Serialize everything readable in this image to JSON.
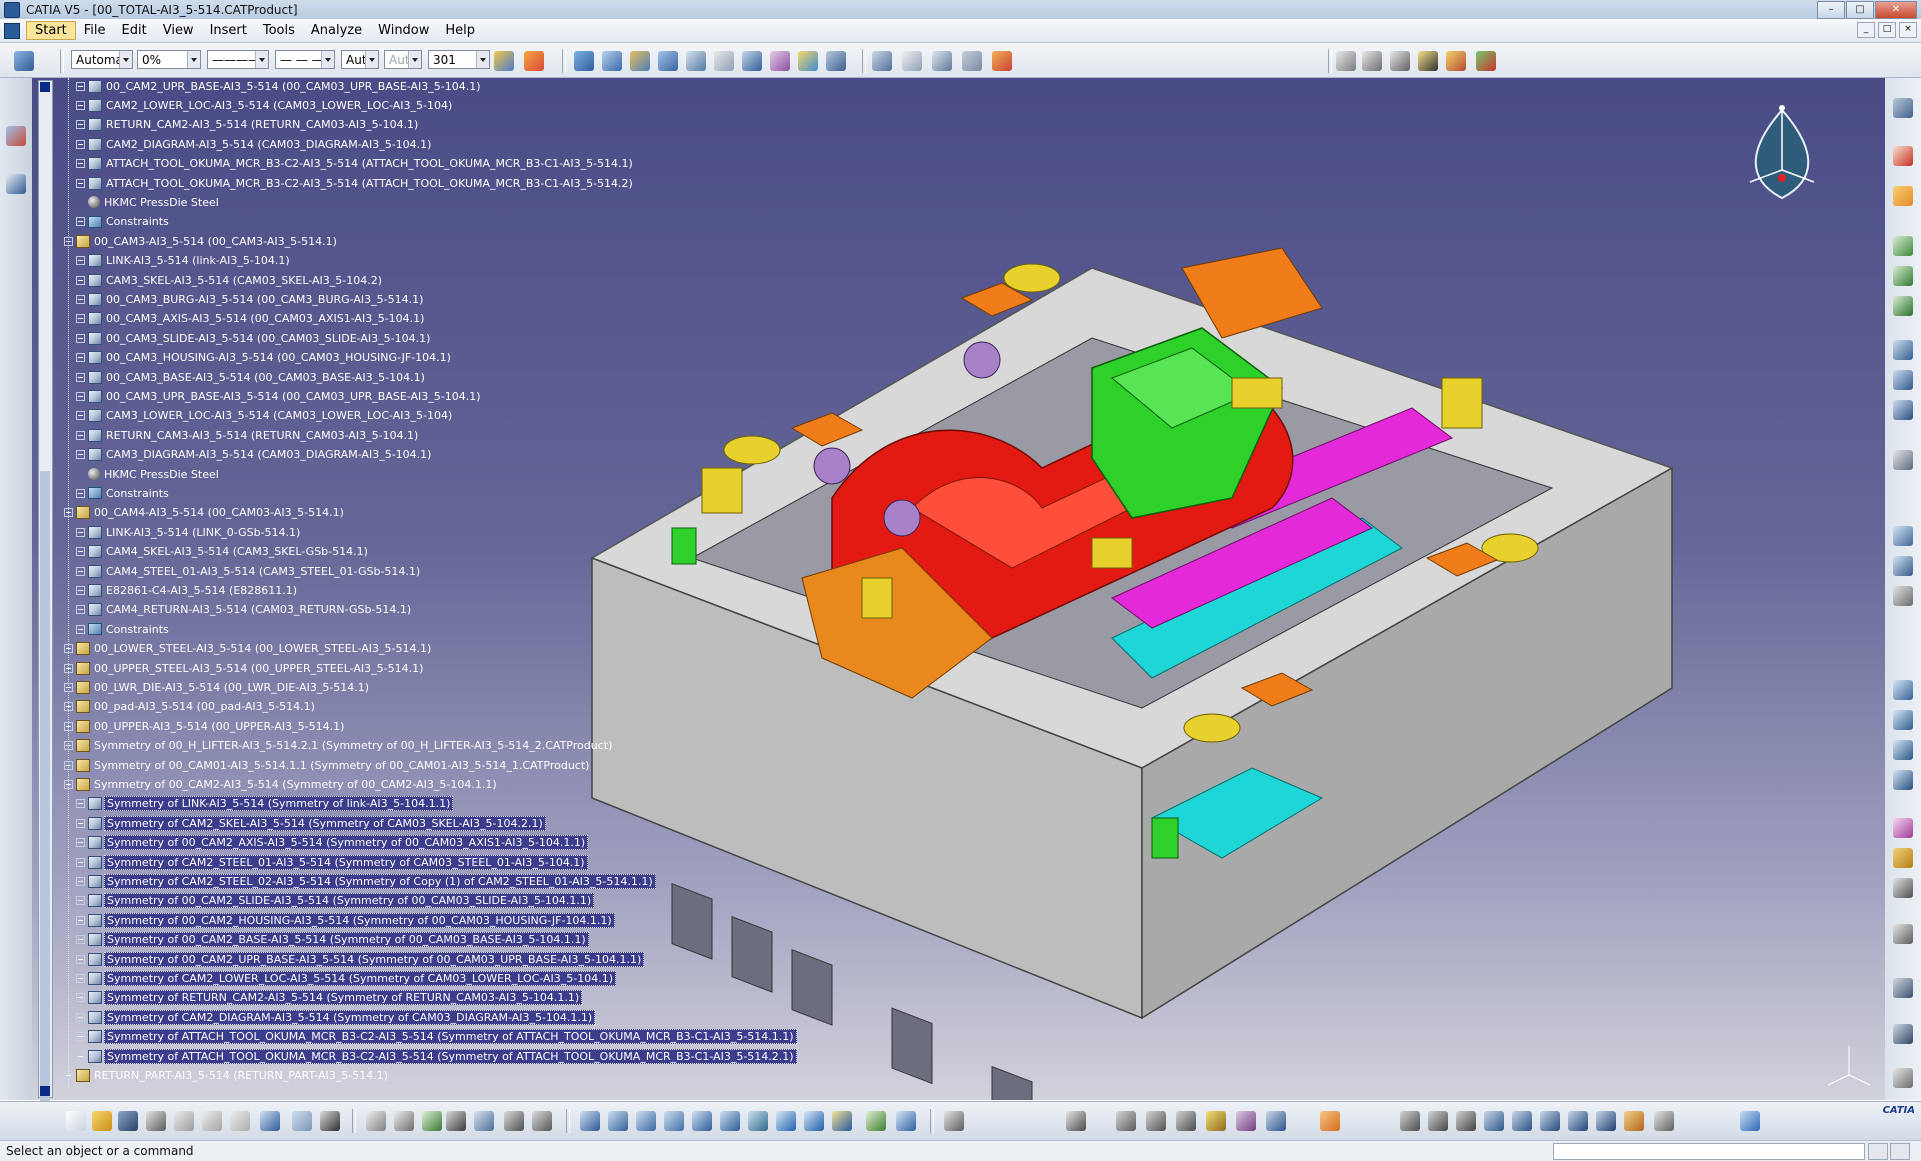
{
  "window": {
    "title": "CATIA V5 - [00_TOTAL-AI3_5-514.CATProduct]",
    "controls": [
      "–",
      "□",
      "✕"
    ]
  },
  "menu": {
    "items": [
      "Start",
      "File",
      "Edit",
      "View",
      "Insert",
      "Tools",
      "Analyze",
      "Window",
      "Help"
    ],
    "mdi_controls": [
      "_",
      "□",
      "×"
    ]
  },
  "properties_toolbar": {
    "color_value": "Automa",
    "transparency_value": "0%",
    "linetype_value": "————",
    "linestyle_value": "— — —",
    "thickness_value": "Aut",
    "point_value": "Aut",
    "layer_value": "301"
  },
  "tree": {
    "nodes": [
      {
        "label": "00_CAM2_UPR_BASE-AI3_5-514 (00_CAM03_UPR_BASE-AI3_5-104.1)",
        "level": 2,
        "icon": "part-icon",
        "expander": "plus",
        "selected": false
      },
      {
        "label": "CAM2_LOWER_LOC-AI3_5-514 (CAM03_LOWER_LOC-AI3_5-104)",
        "level": 2,
        "icon": "part-icon",
        "expander": "plus",
        "selected": false
      },
      {
        "label": "RETURN_CAM2-AI3_5-514 (RETURN_CAM03-AI3_5-104.1)",
        "level": 2,
        "icon": "part-icon",
        "expander": "plus",
        "selected": false
      },
      {
        "label": "CAM2_DIAGRAM-AI3_5-514 (CAM03_DIAGRAM-AI3_5-104.1)",
        "level": 2,
        "icon": "part-icon",
        "expander": "plus",
        "selected": false
      },
      {
        "label": "ATTACH_TOOL_OKUMA_MCR_B3-C2-AI3_5-514 (ATTACH_TOOL_OKUMA_MCR_B3-C1-AI3_5-514.1)",
        "level": 2,
        "icon": "part-icon",
        "expander": "plus",
        "selected": false
      },
      {
        "label": "ATTACH_TOOL_OKUMA_MCR_B3-C2-AI3_5-514 (ATTACH_TOOL_OKUMA_MCR_B3-C1-AI3_5-514.2)",
        "level": 2,
        "icon": "part-icon",
        "expander": "plus",
        "selected": false
      },
      {
        "label": "HKMC PressDie Steel",
        "level": 2,
        "icon": "material-icon",
        "expander": "none",
        "selected": false
      },
      {
        "label": "Constraints",
        "level": 2,
        "icon": "constraints-icon",
        "expander": "plus",
        "selected": false
      },
      {
        "label": "00_CAM3-AI3_5-514 (00_CAM3-AI3_5-514.1)",
        "level": 1,
        "icon": "product-icon",
        "expander": "minus",
        "selected": false
      },
      {
        "label": "LINK-AI3_5-514 (link-AI3_5-104.1)",
        "level": 2,
        "icon": "part-icon",
        "expander": "plus",
        "selected": false
      },
      {
        "label": "CAM3_SKEL-AI3_5-514 (CAM03_SKEL-AI3_5-104.2)",
        "level": 2,
        "icon": "part-icon",
        "expander": "plus",
        "selected": false
      },
      {
        "label": "00_CAM3_BURG-AI3_5-514 (00_CAM3_BURG-AI3_5-514.1)",
        "level": 2,
        "icon": "part-icon",
        "expander": "plus",
        "selected": false
      },
      {
        "label": "00_CAM3_AXIS-AI3_5-514 (00_CAM03_AXIS1-AI3_5-104.1)",
        "level": 2,
        "icon": "part-icon",
        "expander": "plus",
        "selected": false
      },
      {
        "label": "00_CAM3_SLIDE-AI3_5-514 (00_CAM03_SLIDE-AI3_5-104.1)",
        "level": 2,
        "icon": "part-icon",
        "expander": "plus",
        "selected": false
      },
      {
        "label": "00_CAM3_HOUSING-AI3_5-514 (00_CAM03_HOUSING-JF-104.1)",
        "level": 2,
        "icon": "part-icon",
        "expander": "plus",
        "selected": false
      },
      {
        "label": "00_CAM3_BASE-AI3_5-514 (00_CAM03_BASE-AI3_5-104.1)",
        "level": 2,
        "icon": "part-icon",
        "expander": "plus",
        "selected": false
      },
      {
        "label": "00_CAM3_UPR_BASE-AI3_5-514 (00_CAM03_UPR_BASE-AI3_5-104.1)",
        "level": 2,
        "icon": "part-icon",
        "expander": "plus",
        "selected": false
      },
      {
        "label": "CAM3_LOWER_LOC-AI3_5-514 (CAM03_LOWER_LOC-AI3_5-104)",
        "level": 2,
        "icon": "part-icon",
        "expander": "plus",
        "selected": false
      },
      {
        "label": "RETURN_CAM3-AI3_5-514 (RETURN_CAM03-AI3_5-104.1)",
        "level": 2,
        "icon": "part-icon",
        "expander": "plus",
        "selected": false
      },
      {
        "label": "CAM3_DIAGRAM-AI3_5-514 (CAM03_DIAGRAM-AI3_5-104.1)",
        "level": 2,
        "icon": "part-icon",
        "expander": "plus",
        "selected": false
      },
      {
        "label": "HKMC PressDie Steel",
        "level": 2,
        "icon": "material-icon",
        "expander": "none",
        "selected": false
      },
      {
        "label": "Constraints",
        "level": 2,
        "icon": "constraints-icon",
        "expander": "plus",
        "selected": false
      },
      {
        "label": "00_CAM4-AI3_5-514 (00_CAM03-AI3_5-514.1)",
        "level": 1,
        "icon": "product-icon",
        "expander": "minus",
        "selected": false
      },
      {
        "label": "LINK-AI3_5-514 (LINK_0-GSb-514.1)",
        "level": 2,
        "icon": "part-icon",
        "expander": "plus",
        "selected": false
      },
      {
        "label": "CAM4_SKEL-AI3_5-514 (CAM3_SKEL-GSb-514.1)",
        "level": 2,
        "icon": "part-icon",
        "expander": "plus",
        "selected": false
      },
      {
        "label": "CAM4_STEEL_01-AI3_5-514 (CAM3_STEEL_01-GSb-514.1)",
        "level": 2,
        "icon": "part-icon",
        "expander": "plus",
        "selected": false
      },
      {
        "label": "E82861-C4-AI3_5-514 (E828611.1)",
        "level": 2,
        "icon": "part-icon",
        "expander": "plus",
        "selected": false
      },
      {
        "label": "CAM4_RETURN-AI3_5-514 (CAM03_RETURN-GSb-514.1)",
        "level": 2,
        "icon": "part-icon",
        "expander": "plus",
        "selected": false
      },
      {
        "label": "Constraints",
        "level": 2,
        "icon": "constraints-icon",
        "expander": "plus",
        "selected": false
      },
      {
        "label": "00_LOWER_STEEL-AI3_5-514 (00_LOWER_STEEL-AI3_5-514.1)",
        "level": 1,
        "icon": "product-icon",
        "expander": "plus",
        "selected": false
      },
      {
        "label": "00_UPPER_STEEL-AI3_5-514 (00_UPPER_STEEL-AI3_5-514.1)",
        "level": 1,
        "icon": "product-icon",
        "expander": "plus",
        "selected": false
      },
      {
        "label": "00_LWR_DIE-AI3_5-514 (00_LWR_DIE-AI3_5-514.1)",
        "level": 1,
        "icon": "product-icon",
        "expander": "plus",
        "selected": false
      },
      {
        "label": "00_pad-AI3_5-514 (00_pad-AI3_5-514.1)",
        "level": 1,
        "icon": "product-icon",
        "expander": "plus",
        "selected": false
      },
      {
        "label": "00_UPPER-AI3_5-514 (00_UPPER-AI3_5-514.1)",
        "level": 1,
        "icon": "product-icon",
        "expander": "plus",
        "selected": false
      },
      {
        "label": "Symmetry of 00_H_LIFTER-AI3_5-514.2.1 (Symmetry of 00_H_LIFTER-AI3_5-514_2.CATProduct)",
        "level": 1,
        "icon": "product-icon",
        "expander": "plus",
        "selected": false
      },
      {
        "label": "Symmetry of 00_CAM01-AI3_5-514.1.1 (Symmetry of 00_CAM01-AI3_5-514_1.CATProduct)",
        "level": 1,
        "icon": "product-icon",
        "expander": "plus",
        "selected": false
      },
      {
        "label": "Symmetry of 00_CAM2-AI3_5-514 (Symmetry of 00_CAM2-AI3_5-104.1.1)",
        "level": 1,
        "icon": "product-icon",
        "expander": "minus",
        "selected": false
      },
      {
        "label": "Symmetry of LINK-AI3_5-514 (Symmetry of link-AI3_5-104.1.1)",
        "level": 2,
        "icon": "part-icon",
        "expander": "plus",
        "selected": true
      },
      {
        "label": "Symmetry of CAM2_SKEL-AI3_5-514 (Symmetry of CAM03_SKEL-AI3_5-104.2.1)",
        "level": 2,
        "icon": "part-icon",
        "expander": "plus",
        "selected": true
      },
      {
        "label": "Symmetry of 00_CAM2_AXIS-AI3_5-514 (Symmetry of 00_CAM03_AXIS1-AI3_5-104.1.1)",
        "level": 2,
        "icon": "part-icon",
        "expander": "plus",
        "selected": true
      },
      {
        "label": "Symmetry of CAM2_STEEL_01-AI3_5-514 (Symmetry of CAM03_STEEL_01-AI3_5-104.1)",
        "level": 2,
        "icon": "part-icon",
        "expander": "plus",
        "selected": true
      },
      {
        "label": "Symmetry of CAM2_STEEL_02-AI3_5-514 (Symmetry of Copy (1) of CAM2_STEEL_01-AI3_5-514.1.1)",
        "level": 2,
        "icon": "part-icon",
        "expander": "plus",
        "selected": true
      },
      {
        "label": "Symmetry of 00_CAM2_SLIDE-AI3_5-514 (Symmetry of 00_CAM03_SLIDE-AI3_5-104.1.1)",
        "level": 2,
        "icon": "part-icon",
        "expander": "plus",
        "selected": true
      },
      {
        "label": "Symmetry of 00_CAM2_HOUSING-AI3_5-514 (Symmetry of 00_CAM03_HOUSING-JF-104.1.1)",
        "level": 2,
        "icon": "part-icon",
        "expander": "plus",
        "selected": true
      },
      {
        "label": "Symmetry of 00_CAM2_BASE-AI3_5-514 (Symmetry of 00_CAM03_BASE-AI3_5-104.1.1)",
        "level": 2,
        "icon": "part-icon",
        "expander": "plus",
        "selected": true
      },
      {
        "label": "Symmetry of 00_CAM2_UPR_BASE-AI3_5-514 (Symmetry of 00_CAM03_UPR_BASE-AI3_5-104.1.1)",
        "level": 2,
        "icon": "part-icon",
        "expander": "plus",
        "selected": true
      },
      {
        "label": "Symmetry of CAM2_LOWER_LOC-AI3_5-514 (Symmetry of CAM03_LOWER_LOC-AI3_5-104.1)",
        "level": 2,
        "icon": "part-icon",
        "expander": "plus",
        "selected": true
      },
      {
        "label": "Symmetry of RETURN_CAM2-AI3_5-514 (Symmetry of RETURN_CAM03-AI3_5-104.1.1)",
        "level": 2,
        "icon": "part-icon",
        "expander": "plus",
        "selected": true
      },
      {
        "label": "Symmetry of CAM2_DIAGRAM-AI3_5-514 (Symmetry of CAM03_DIAGRAM-AI3_5-104.1.1)",
        "level": 2,
        "icon": "part-icon",
        "expander": "plus",
        "selected": true
      },
      {
        "label": "Symmetry of ATTACH_TOOL_OKUMA_MCR_B3-C2-AI3_5-514 (Symmetry of ATTACH_TOOL_OKUMA_MCR_B3-C1-AI3_5-514.1.1)",
        "level": 2,
        "icon": "part-icon",
        "expander": "plus",
        "selected": true
      },
      {
        "label": "Symmetry of ATTACH_TOOL_OKUMA_MCR_B3-C2-AI3_5-514 (Symmetry of ATTACH_TOOL_OKUMA_MCR_B3-C1-AI3_5-514.2.1)",
        "level": 2,
        "icon": "part-icon",
        "expander": "plus",
        "selected": true
      },
      {
        "label": "RETURN_PART-AI3_5-514 (RETURN_PART-AI3_5-514.1)",
        "level": 1,
        "icon": "product-icon",
        "expander": "plus",
        "selected": false
      }
    ]
  },
  "status": {
    "text": "Select an object or a command"
  },
  "logo": {
    "text": "CATIA"
  },
  "colors": {
    "viewport_top": "#4a4b86",
    "viewport_bottom": "#d2d2dc",
    "selection": "#3c3c8c",
    "steel_gray": "#d9d9d9",
    "red_part": "#e21a12",
    "green_part": "#2ed12a",
    "magenta_part": "#e42ad8",
    "cyan_part": "#1fd6d6",
    "orange_part": "#f07d1a",
    "yellow_part": "#e8d12c"
  }
}
